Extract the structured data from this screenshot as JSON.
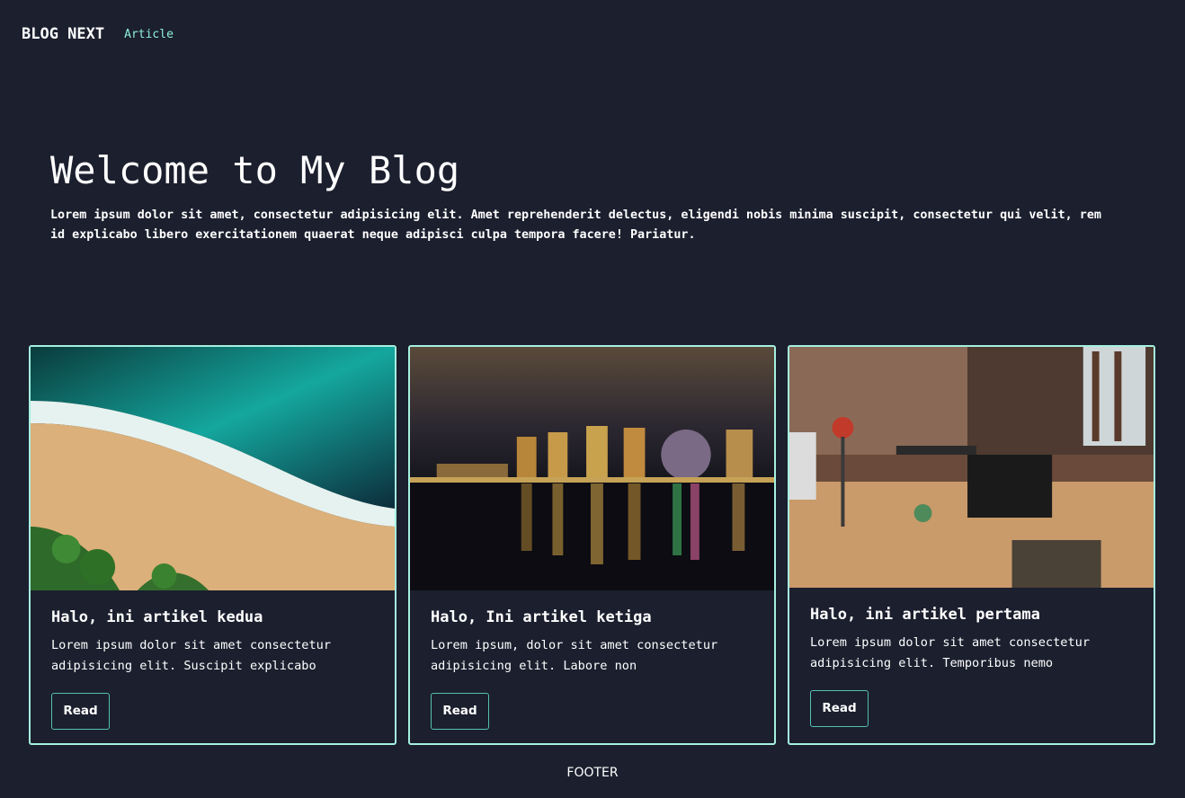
{
  "nav": {
    "brand": "BLOG NEXT",
    "links": [
      "Article"
    ]
  },
  "hero": {
    "title": "Welcome to My Blog",
    "text": "Lorem ipsum dolor sit amet, consectetur adipisicing elit. Amet reprehenderit delectus, eligendi nobis minima suscipit, consectetur qui velit, rem id explicabo libero exercitationem quaerat neque adipisci culpa tempora facere! Pariatur."
  },
  "cards": [
    {
      "title": "Halo, ini artikel kedua",
      "text": "Lorem ipsum dolor sit amet consectetur adipisicing elit. Suscipit explicabo",
      "button": "Read"
    },
    {
      "title": "Halo, Ini artikel ketiga",
      "text": "Lorem ipsum, dolor sit amet consectetur adipisicing elit. Labore non",
      "button": "Read"
    },
    {
      "title": "Halo, ini artikel pertama",
      "text": "Lorem ipsum dolor sit amet consectetur adipisicing elit. Temporibus nemo",
      "button": "Read"
    }
  ],
  "footer": {
    "text": "FOOTER"
  },
  "colors": {
    "background": "#1b1f2e",
    "accent": "#a6f0e0",
    "link": "#8ff0d8"
  }
}
